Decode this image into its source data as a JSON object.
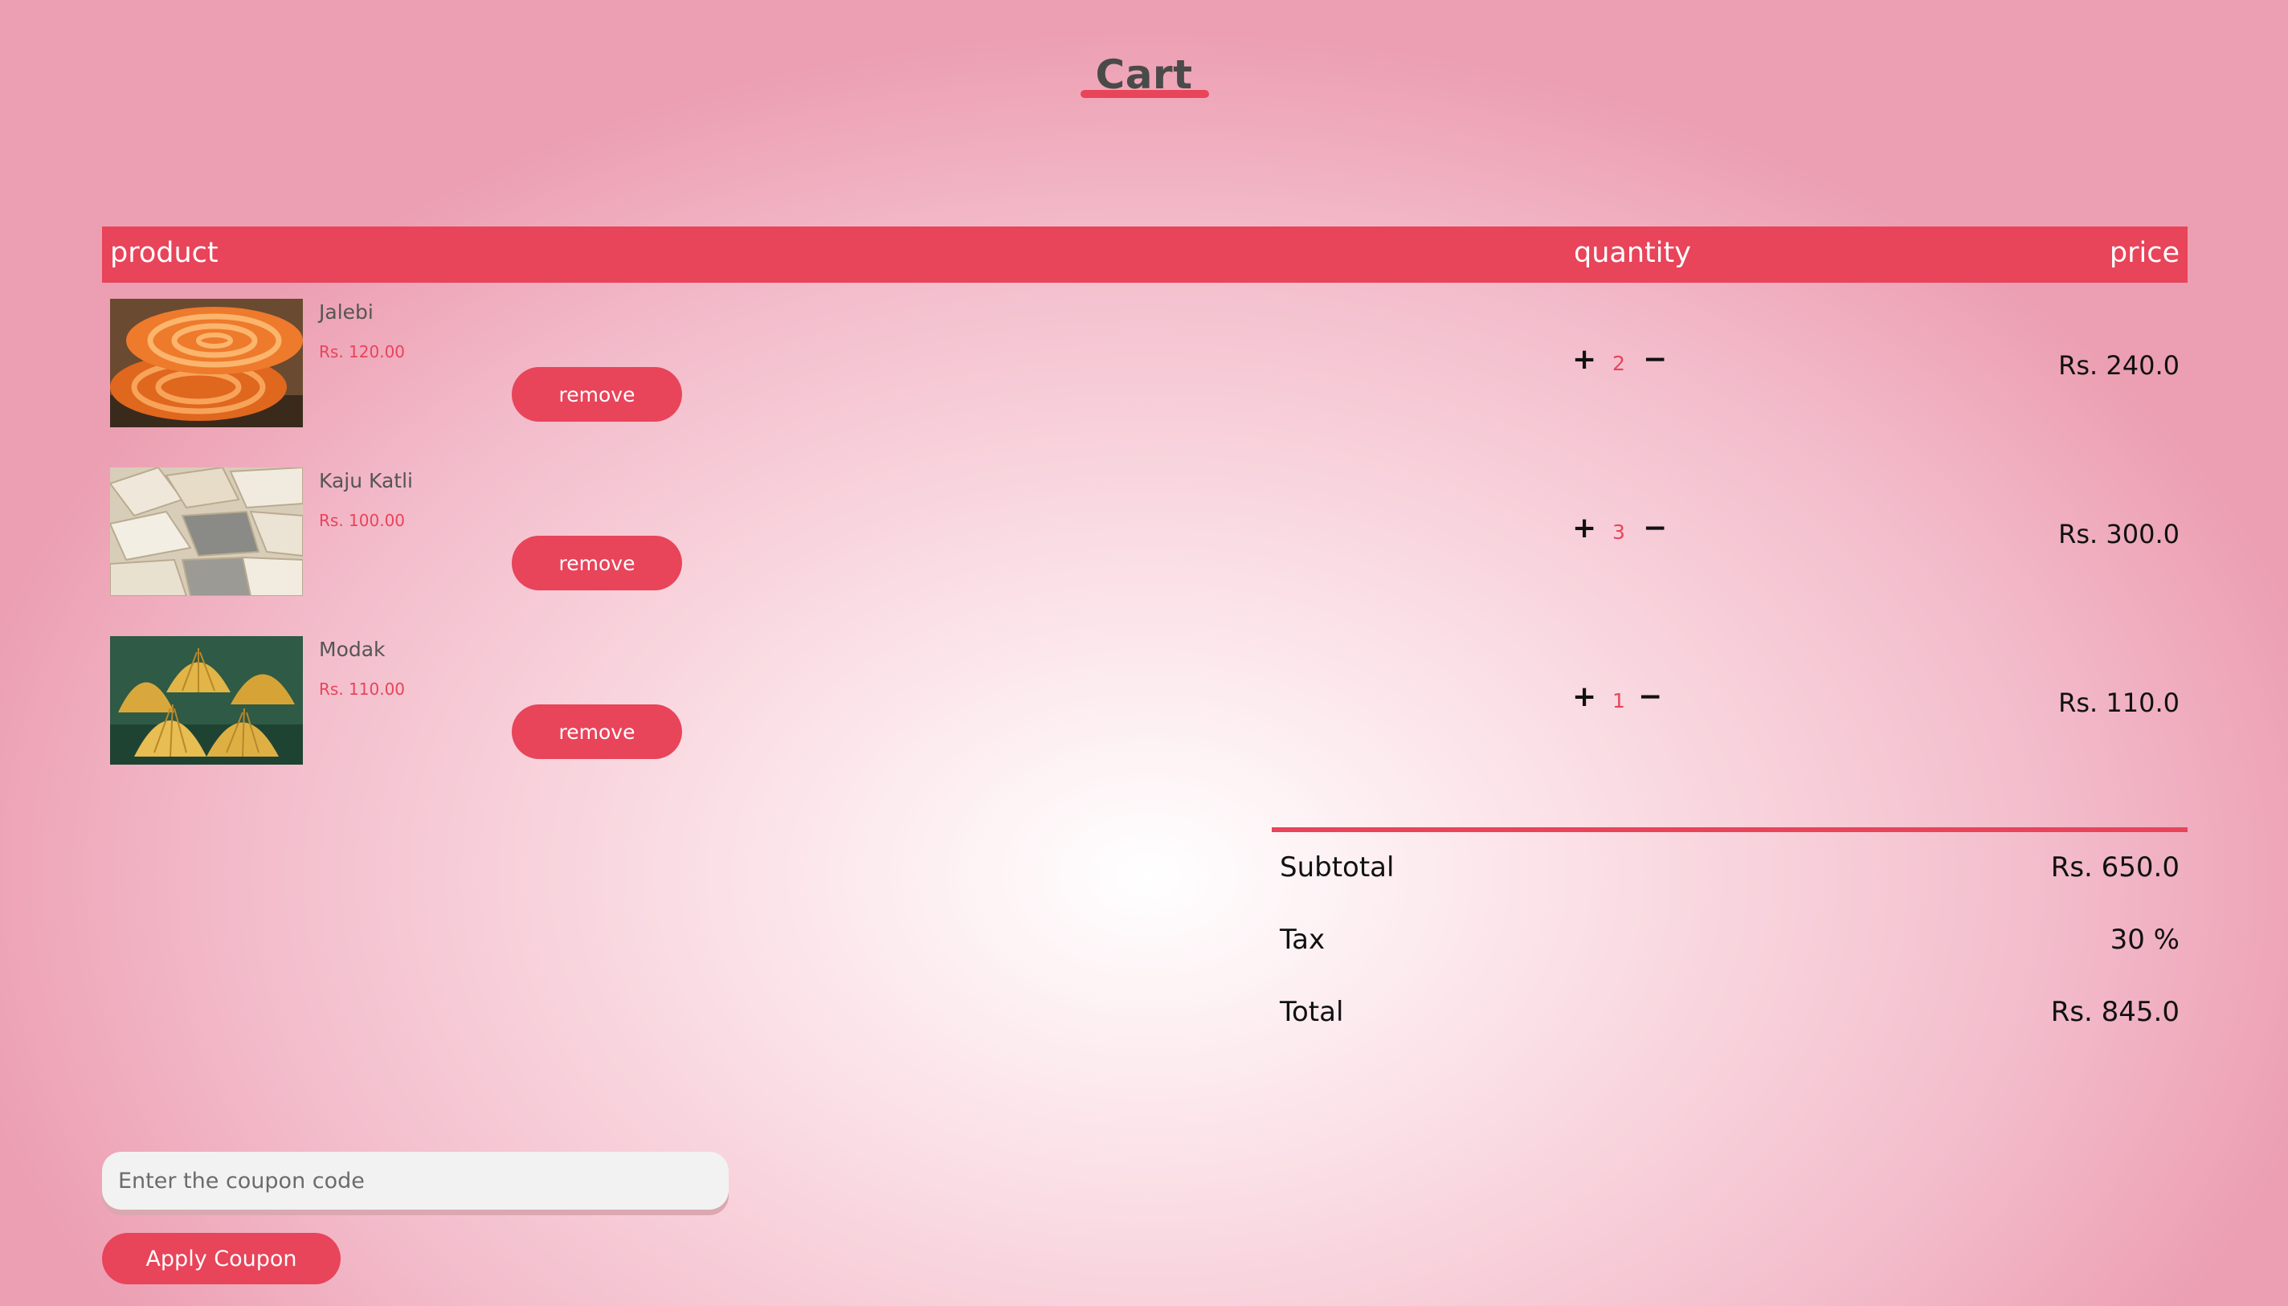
{
  "page": {
    "title": "Cart"
  },
  "table": {
    "headers": {
      "product": "product",
      "quantity": "quantity",
      "price": "price"
    }
  },
  "items": [
    {
      "name": "Jalebi",
      "unit_price": "Rs. 120.00",
      "quantity": "2",
      "line_total": "Rs. 240.0",
      "remove_label": "remove"
    },
    {
      "name": "Kaju Katli",
      "unit_price": "Rs. 100.00",
      "quantity": "3",
      "line_total": "Rs. 300.0",
      "remove_label": "remove"
    },
    {
      "name": "Modak",
      "unit_price": "Rs. 110.00",
      "quantity": "1",
      "line_total": "Rs. 110.0",
      "remove_label": "remove"
    }
  ],
  "summary": {
    "subtotal_label": "Subtotal",
    "subtotal_value": "Rs. 650.0",
    "tax_label": "Tax",
    "tax_value": "30 %",
    "total_label": "Total",
    "total_value": "Rs. 845.0"
  },
  "coupon": {
    "placeholder": "Enter the coupon code",
    "apply_label": "Apply Coupon"
  },
  "icons": {
    "increase": "plus-icon",
    "decrease": "minus-icon"
  },
  "colors": {
    "accent": "#e8445a",
    "heading": "#4a4a4a"
  }
}
